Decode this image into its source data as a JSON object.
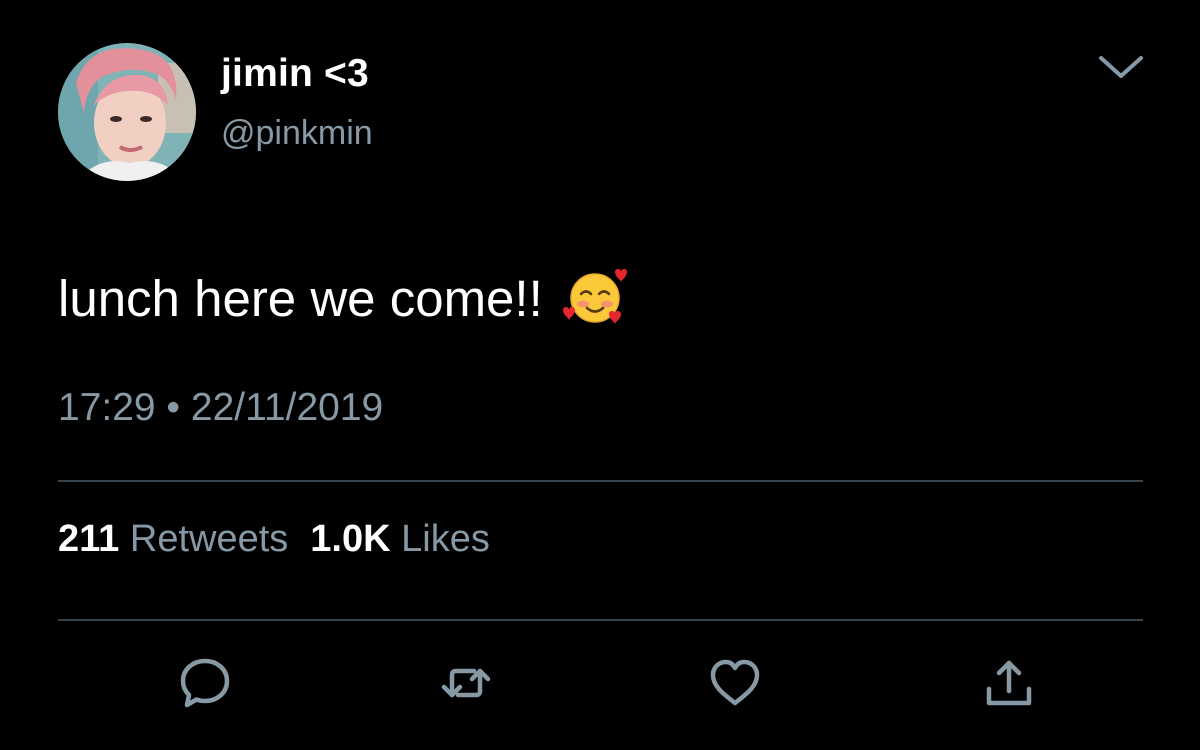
{
  "author": {
    "display_name": "jimin <3",
    "handle": "@pinkmin",
    "avatar_icon": "profile-photo"
  },
  "tweet": {
    "text": "lunch here we come!!",
    "emoji": "smiling-face-with-hearts",
    "timestamp": "17:29 • 22/11/2019"
  },
  "stats": {
    "retweets_count": "211",
    "retweets_label": "Retweets",
    "likes_count": "1.0K",
    "likes_label": "Likes"
  },
  "actions": {
    "reply_icon": "reply-icon",
    "retweet_icon": "retweet-icon",
    "like_icon": "heart-icon",
    "share_icon": "share-icon",
    "menu_icon": "chevron-down-icon"
  },
  "colors": {
    "background": "#000000",
    "primary_text": "#ffffff",
    "secondary_text": "#8899a6",
    "divider": "#38444d",
    "icon": "#8899a6"
  }
}
